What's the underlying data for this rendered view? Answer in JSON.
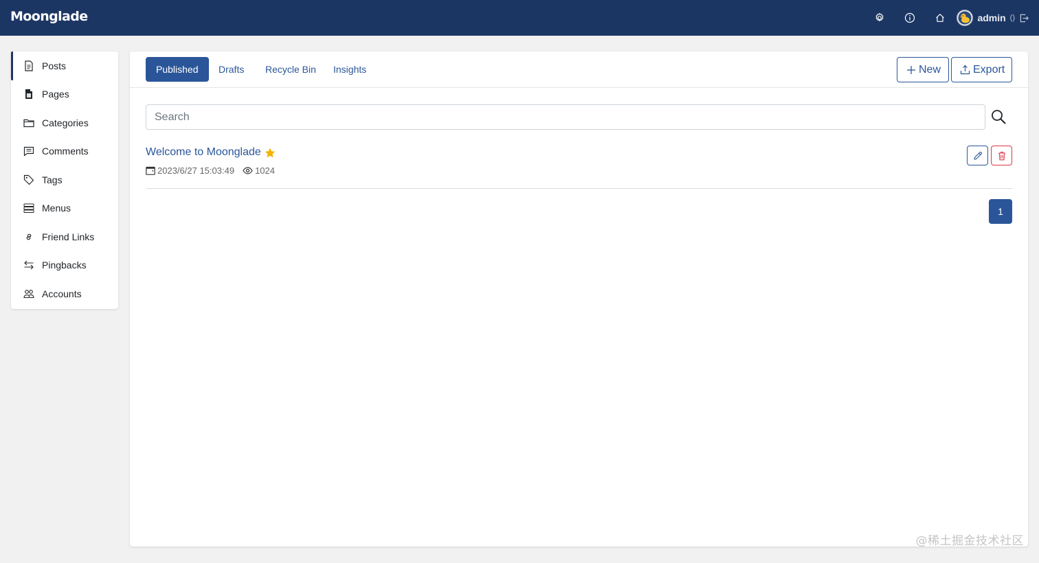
{
  "navbar": {
    "brand": "Moonglade",
    "icons": [
      "gear-icon",
      "info-icon",
      "home-icon"
    ],
    "user": {
      "name": "admin",
      "extra": "()"
    }
  },
  "sidebar": {
    "items": [
      {
        "label": "Posts",
        "icon": "file-text-icon",
        "active": true
      },
      {
        "label": "Pages",
        "icon": "file-icon",
        "active": false
      },
      {
        "label": "Categories",
        "icon": "folder-icon",
        "active": false
      },
      {
        "label": "Comments",
        "icon": "comment-icon",
        "active": false
      },
      {
        "label": "Tags",
        "icon": "tag-icon",
        "active": false
      },
      {
        "label": "Menus",
        "icon": "menu-list-icon",
        "active": false
      },
      {
        "label": "Friend Links",
        "icon": "link-icon",
        "active": false
      },
      {
        "label": "Pingbacks",
        "icon": "arrows-icon",
        "active": false
      },
      {
        "label": "Accounts",
        "icon": "people-icon",
        "active": false
      }
    ]
  },
  "tabs": [
    {
      "label": "Published",
      "active": true
    },
    {
      "label": "Drafts",
      "active": false
    },
    {
      "label": "Recycle Bin",
      "active": false
    },
    {
      "label": "Insights",
      "active": false
    }
  ],
  "toolbar": {
    "new_label": "New",
    "export_label": "Export"
  },
  "search": {
    "placeholder": "Search",
    "value": ""
  },
  "posts": [
    {
      "title": "Welcome to Moonglade",
      "featured": true,
      "date": "2023/6/27 15:03:49",
      "views": "1024"
    }
  ],
  "pagination": {
    "current": "1"
  },
  "watermark": "@稀土掘金技术社区",
  "colors": {
    "navbar": "#1c3664",
    "primary": "#2a5699",
    "danger": "#dc3545",
    "star": "#f5b300"
  }
}
